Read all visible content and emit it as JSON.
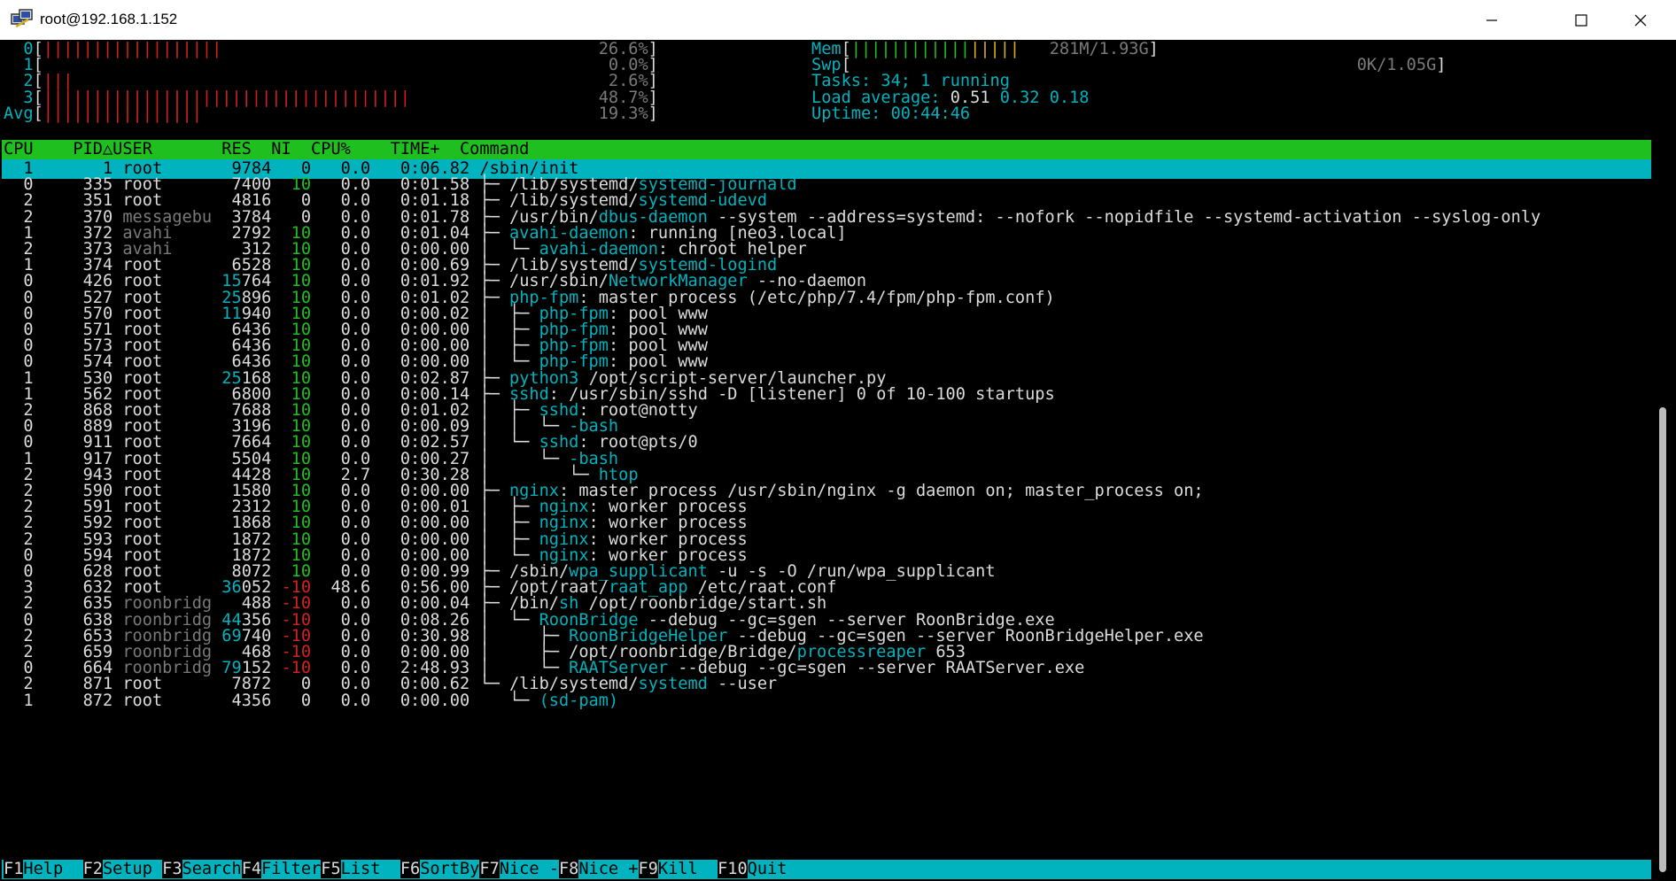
{
  "window": {
    "title": "root@192.168.1.152"
  },
  "colors": {
    "cyan": "#00b3be",
    "green": "#1fbf1f",
    "red": "#d52020",
    "white": "#dcdcdc",
    "gray": "#7a7a7a",
    "blue": "#2c5cd6",
    "yellow": "#d6b020",
    "black": "#000000",
    "header_bg": "#1fbf1f",
    "selected_bg": "#00b3be"
  },
  "meters": {
    "cpu": [
      {
        "label": "0",
        "bars": "||||||||||||||||||",
        "pct": "26.6%",
        "color": "red"
      },
      {
        "label": "1",
        "bars": "",
        "pct": "0.0%",
        "color": "red"
      },
      {
        "label": "2",
        "bars": "|||",
        "pct": "2.6%",
        "color": "red"
      },
      {
        "label": "3",
        "bars": "|||||||||||||||||||||||||||||||||||||",
        "pct": "48.7%",
        "color": "red"
      },
      {
        "label": "Avg",
        "bars": "||||||||||||||||",
        "pct": "19.3%",
        "color": "red"
      }
    ],
    "mem": {
      "label": "Mem",
      "bars_green": "||||||||||||",
      "bars_yellow": "|||||",
      "value": "281M/1.93G"
    },
    "swp": {
      "label": "Swp",
      "value": "0K/1.05G"
    },
    "tasks": {
      "label": "Tasks:",
      "value": "34; 1 running"
    },
    "load": {
      "label": "Load average:",
      "v1": "0.51",
      "v2": "0.32",
      "v3": "0.18"
    },
    "uptime": {
      "label": "Uptime:",
      "value": "00:44:46"
    }
  },
  "columns": [
    "CPU",
    "PID△",
    "USER",
    "RES",
    "NI",
    "CPU%",
    "TIME+",
    "Command"
  ],
  "processes": [
    [
      "1",
      "1",
      "root",
      "9784",
      "0",
      "0.0",
      "0:06.82",
      "",
      "/sbin/init"
    ],
    [
      "0",
      "335",
      "root",
      "7400",
      "10",
      "0.0",
      "0:01.58",
      "├─ ",
      "/lib/systemd/systemd-journald"
    ],
    [
      "2",
      "351",
      "root",
      "4816",
      "0",
      "0.0",
      "0:01.18",
      "├─ ",
      "/lib/systemd/systemd-udevd"
    ],
    [
      "2",
      "370",
      "messagebu",
      "3784",
      "0",
      "0.0",
      "0:01.78",
      "├─ ",
      "/usr/bin/dbus-daemon --system --address=systemd: --nofork --nopidfile --systemd-activation --syslog-only"
    ],
    [
      "1",
      "372",
      "avahi",
      "2792",
      "10",
      "0.0",
      "0:01.04",
      "├─ ",
      "avahi-daemon: running [neo3.local]"
    ],
    [
      "2",
      "373",
      "avahi",
      "312",
      "10",
      "0.0",
      "0:00.00",
      "│  └─ ",
      "avahi-daemon: chroot helper"
    ],
    [
      "1",
      "374",
      "root",
      "6528",
      "10",
      "0.0",
      "0:00.69",
      "├─ ",
      "/lib/systemd/systemd-logind"
    ],
    [
      "0",
      "426",
      "root",
      "15764",
      "10",
      "0.0",
      "0:01.92",
      "├─ ",
      "/usr/sbin/NetworkManager --no-daemon"
    ],
    [
      "0",
      "527",
      "root",
      "25896",
      "10",
      "0.0",
      "0:01.02",
      "├─ ",
      "php-fpm: master process (/etc/php/7.4/fpm/php-fpm.conf)"
    ],
    [
      "0",
      "570",
      "root",
      "11940",
      "10",
      "0.0",
      "0:00.02",
      "│  ├─ ",
      "php-fpm: pool www"
    ],
    [
      "0",
      "571",
      "root",
      "6436",
      "10",
      "0.0",
      "0:00.00",
      "│  ├─ ",
      "php-fpm: pool www"
    ],
    [
      "0",
      "573",
      "root",
      "6436",
      "10",
      "0.0",
      "0:00.00",
      "│  ├─ ",
      "php-fpm: pool www"
    ],
    [
      "0",
      "574",
      "root",
      "6436",
      "10",
      "0.0",
      "0:00.00",
      "│  └─ ",
      "php-fpm: pool www"
    ],
    [
      "1",
      "530",
      "root",
      "25168",
      "10",
      "0.0",
      "0:02.87",
      "├─ ",
      "python3 /opt/script-server/launcher.py"
    ],
    [
      "1",
      "562",
      "root",
      "6800",
      "10",
      "0.0",
      "0:00.14",
      "├─ ",
      "sshd: /usr/sbin/sshd -D [listener] 0 of 10-100 startups"
    ],
    [
      "2",
      "868",
      "root",
      "7688",
      "10",
      "0.0",
      "0:01.02",
      "│  ├─ ",
      "sshd: root@notty"
    ],
    [
      "0",
      "889",
      "root",
      "3196",
      "10",
      "0.0",
      "0:00.09",
      "│  │  └─ ",
      "-bash"
    ],
    [
      "0",
      "911",
      "root",
      "7664",
      "10",
      "0.0",
      "0:02.57",
      "│  └─ ",
      "sshd: root@pts/0"
    ],
    [
      "1",
      "917",
      "root",
      "5504",
      "10",
      "0.0",
      "0:00.27",
      "│     └─ ",
      "-bash"
    ],
    [
      "2",
      "943",
      "root",
      "4428",
      "10",
      "2.7",
      "0:30.28",
      "│        └─ ",
      "htop"
    ],
    [
      "2",
      "590",
      "root",
      "1580",
      "10",
      "0.0",
      "0:00.00",
      "├─ ",
      "nginx: master process /usr/sbin/nginx -g daemon on; master_process on;"
    ],
    [
      "2",
      "591",
      "root",
      "2312",
      "10",
      "0.0",
      "0:00.01",
      "│  ├─ ",
      "nginx: worker process"
    ],
    [
      "2",
      "592",
      "root",
      "1868",
      "10",
      "0.0",
      "0:00.00",
      "│  ├─ ",
      "nginx: worker process"
    ],
    [
      "2",
      "593",
      "root",
      "1872",
      "10",
      "0.0",
      "0:00.00",
      "│  ├─ ",
      "nginx: worker process"
    ],
    [
      "0",
      "594",
      "root",
      "1872",
      "10",
      "0.0",
      "0:00.00",
      "│  └─ ",
      "nginx: worker process"
    ],
    [
      "0",
      "628",
      "root",
      "8072",
      "10",
      "0.0",
      "0:00.99",
      "├─ ",
      "/sbin/wpa_supplicant -u -s -O /run/wpa_supplicant"
    ],
    [
      "3",
      "632",
      "root",
      "36052",
      "-10",
      "48.6",
      "0:56.00",
      "├─ ",
      "/opt/raat/raat_app /etc/raat.conf"
    ],
    [
      "2",
      "635",
      "roonbridg",
      "488",
      "-10",
      "0.0",
      "0:00.04",
      "├─ ",
      "/bin/sh /opt/roonbridge/start.sh"
    ],
    [
      "0",
      "638",
      "roonbridg",
      "44356",
      "-10",
      "0.0",
      "0:08.26",
      "│  └─ ",
      "RoonBridge --debug --gc=sgen --server RoonBridge.exe"
    ],
    [
      "2",
      "653",
      "roonbridg",
      "69740",
      "-10",
      "0.0",
      "0:30.98",
      "│     ├─ ",
      "RoonBridgeHelper --debug --gc=sgen --server RoonBridgeHelper.exe"
    ],
    [
      "2",
      "659",
      "roonbridg",
      "468",
      "-10",
      "0.0",
      "0:00.00",
      "│     ├─ ",
      "/opt/roonbridge/Bridge/processreaper 653"
    ],
    [
      "0",
      "664",
      "roonbridg",
      "79152",
      "-10",
      "0.0",
      "2:48.93",
      "│     └─ ",
      "RAATServer --debug --gc=sgen --server RAATServer.exe"
    ],
    [
      "2",
      "871",
      "root",
      "7872",
      "0",
      "0.0",
      "0:00.62",
      "└─ ",
      "/lib/systemd/systemd --user"
    ],
    [
      "1",
      "872",
      "root",
      "4356",
      "0",
      "0.0",
      "0:00.00",
      "   └─ ",
      "(sd-pam)"
    ]
  ],
  "function_keys": [
    {
      "key": "F1",
      "label": "Help  "
    },
    {
      "key": "F2",
      "label": "Setup "
    },
    {
      "key": "F3",
      "label": "Search"
    },
    {
      "key": "F4",
      "label": "Filter"
    },
    {
      "key": "F5",
      "label": "List  "
    },
    {
      "key": "F6",
      "label": "SortBy"
    },
    {
      "key": "F7",
      "label": "Nice -"
    },
    {
      "key": "F8",
      "label": "Nice +"
    },
    {
      "key": "F9",
      "label": "Kill  "
    },
    {
      "key": "F10",
      "label": "Quit"
    }
  ]
}
